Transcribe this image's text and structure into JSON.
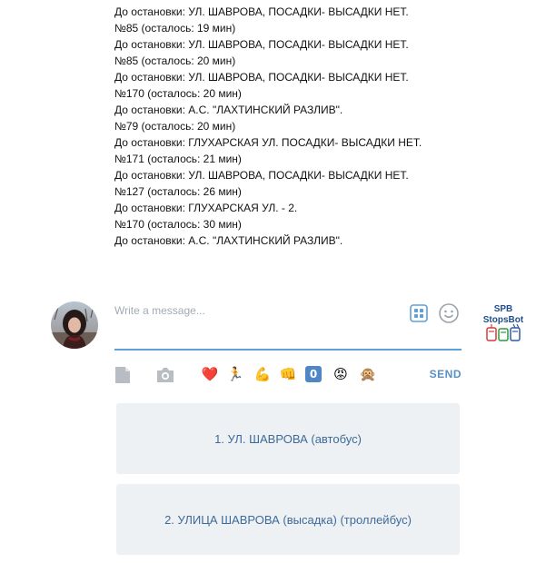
{
  "messages": [
    "До остановки: УЛ. ШАВРОВА, ПОСАДКИ- ВЫСАДКИ НЕТ.",
    "№85 (осталось: 19 мин)",
    "До остановки: УЛ. ШАВРОВА, ПОСАДКИ- ВЫСАДКИ НЕТ.",
    "№85 (осталось: 20 мин)",
    "До остановки: УЛ. ШАВРОВА, ПОСАДКИ- ВЫСАДКИ НЕТ.",
    "№170 (осталось: 20 мин)",
    "До остановки: А.С. \"ЛАХТИНСКИЙ РАЗЛИВ\".",
    "№79 (осталось: 20 мин)",
    "До остановки: ГЛУХАРСКАЯ УЛ. ПОСАДКИ- ВЫСАДКИ НЕТ.",
    "№171 (осталось: 21 мин)",
    "До остановки: УЛ. ШАВРОВА, ПОСАДКИ- ВЫСАДКИ НЕТ.",
    "№127 (осталось: 26 мин)",
    "До остановки: ГЛУХАРСКАЯ УЛ. - 2.",
    "№170 (осталось: 30 мин)",
    "До остановки: А.С. \"ЛАХТИНСКИЙ РАЗЛИВ\"."
  ],
  "composer": {
    "placeholder": "Write a message...",
    "value": ""
  },
  "bot": {
    "line1": "SPB",
    "line2": "StopsBot",
    "icons": [
      "tram-icon",
      "bus-icon",
      "trolleybus-icon"
    ]
  },
  "toolbar": {
    "send_label": "SEND",
    "emojis": [
      {
        "name": "heart-emoji",
        "char": "❤️"
      },
      {
        "name": "runner-emoji",
        "char": "🏃"
      },
      {
        "name": "flexed-biceps-emoji",
        "char": "💪"
      },
      {
        "name": "fist-emoji",
        "char": "👊"
      },
      {
        "name": "keycap-zero-emoji",
        "char": "0"
      },
      {
        "name": "angry-face-emoji",
        "char": "😡"
      },
      {
        "name": "monkey-emoji",
        "char": "🙊"
      }
    ]
  },
  "keyboard": {
    "buttons": [
      "1. УЛ. ШАВРОВА (автобус)",
      "2. УЛИЦА ШАВРОВА (высадка) (троллейбус)"
    ]
  },
  "colors": {
    "accent": "#5fa0d8",
    "send": "#5b8fc4",
    "keyboard_bg": "#edf1f4",
    "keyboard_text": "#3e6a99"
  }
}
